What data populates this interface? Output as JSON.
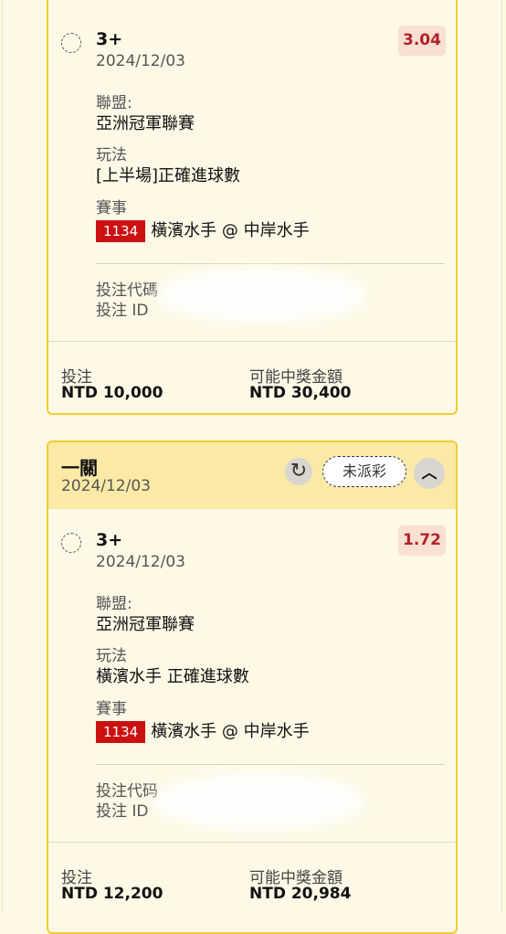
{
  "cards": [
    {
      "leg": {
        "title": "3+",
        "date": "2024/12/03",
        "odds": "3.04",
        "league_label": "聯盟:",
        "league": "亞洲冠軍聯賽",
        "market_label": "玩法",
        "market": "[上半場]正確進球數",
        "event_label": "賽事",
        "match_no": "1134",
        "match": "橫濱水手 @ 中岸水手",
        "bet_code_label": "投注代碼",
        "bet_id_label": "投注 ID"
      },
      "footer": {
        "stake_label": "投注",
        "stake": "NTD 10,000",
        "payout_label": "可能中獎金額",
        "payout": "NTD 30,400"
      }
    },
    {
      "header": {
        "title": "一關",
        "date": "2024/12/03",
        "refresh_icon": "refresh-icon",
        "status": "未派彩",
        "collapse_icon": "chevron-up-icon"
      },
      "leg": {
        "title": "3+",
        "date": "2024/12/03",
        "odds": "1.72",
        "league_label": "聯盟:",
        "league": "亞洲冠軍聯賽",
        "market_label": "玩法",
        "market": "橫濱水手 正確進球數",
        "event_label": "賽事",
        "match_no": "1134",
        "match": "橫濱水手 @ 中岸水手",
        "bet_code_label": "投注代码",
        "bet_id_label": "投注 ID"
      },
      "footer": {
        "stake_label": "投注",
        "stake": "NTD 12,200",
        "payout_label": "可能中獎金額",
        "payout": "NTD 20,984"
      }
    }
  ],
  "colors": {
    "background": "#fdf9e6",
    "card_border": "#f2cc2d",
    "header_bg": "#fbeaa6",
    "odds_text": "#b3202b",
    "odds_bg": "#f8e0d2",
    "match_badge": "#cc1111"
  }
}
